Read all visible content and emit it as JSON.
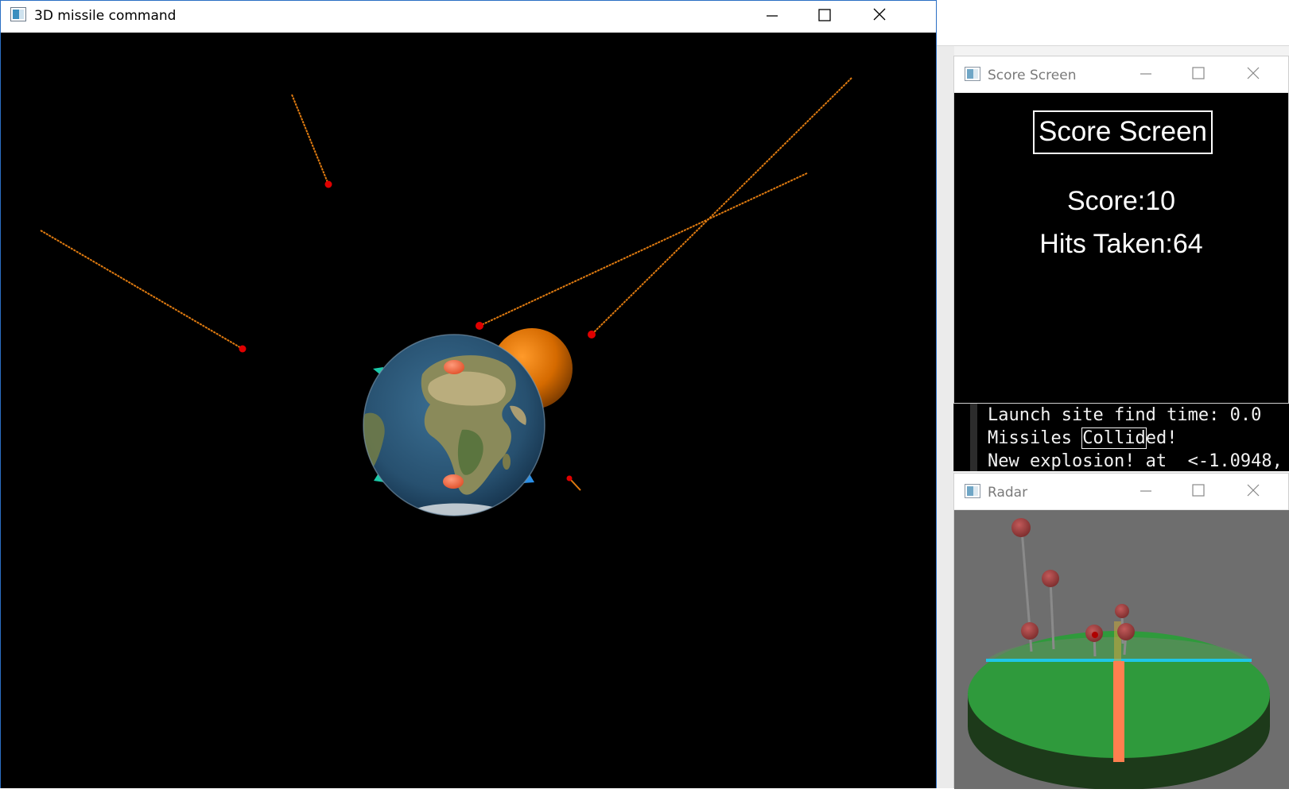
{
  "main_window": {
    "title": "3D missile command",
    "icon": "app-window-icon",
    "controls": [
      "minimize-icon",
      "maximize-icon",
      "close-icon"
    ]
  },
  "score_window": {
    "title": "Score Screen",
    "heading": "Score Screen",
    "score_text": "Score:10",
    "hits_text": "Hits Taken:64",
    "controls": [
      "minimize-icon",
      "maximize-icon",
      "close-icon"
    ]
  },
  "console": {
    "line1": "Launch site find time: 0.0",
    "line2_prefix": "Missiles ",
    "line2_highlight": "Collid",
    "line2_suffix": "ed!",
    "line3": "New explosion! at  <-1.0948,"
  },
  "radar_window": {
    "title": "Radar",
    "controls": [
      "minimize-icon",
      "maximize-icon",
      "close-icon"
    ]
  },
  "colors": {
    "space": "#000000",
    "trail": "#e07b10",
    "warhead": "#e00000",
    "ocean": "#2f5f82",
    "shield": "#e07000",
    "radar_ground": "#2f9a3c",
    "radar_bg": "#6e6e6e",
    "radar_beam": "#ff7f4f",
    "radar_line": "#1fc6e6"
  }
}
